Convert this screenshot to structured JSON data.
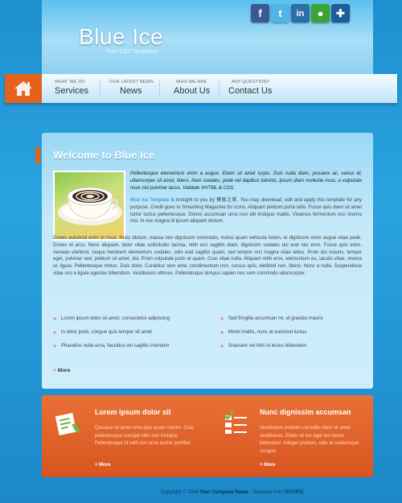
{
  "header": {
    "title": "Blue Ice",
    "tagline": "Free CSS Templates",
    "social": [
      {
        "name": "facebook-icon",
        "glyph": "f"
      },
      {
        "name": "twitter-icon",
        "glyph": "t"
      },
      {
        "name": "linkedin-icon",
        "glyph": "in"
      },
      {
        "name": "chat-icon",
        "glyph": "●"
      },
      {
        "name": "myspace-icon",
        "glyph": "✚"
      }
    ]
  },
  "nav": {
    "items": [
      {
        "small": "WHAT WE DO",
        "label": "Services"
      },
      {
        "small": "OUR LATEST NEWS",
        "label": "News"
      },
      {
        "small": "WHO WE ARE",
        "label": "About Us"
      },
      {
        "small": "ANY QUESTION?",
        "label": "Contact Us"
      }
    ]
  },
  "main": {
    "heading": "Welcome to Blue Ice",
    "intro": "Pellentesque elementum enim a augue. Etiam sit amet turpis. Duis nulla diam, posuere ac, varius id, ullamcorper sit amet, libero. Nam sodales, pede vel dapibus lobortis, ipsum diam molestie risus, a vulputate risus nisl pulvinar lacus. Validate XHTML & CSS.",
    "p2_prefix": "Blue Ice Template",
    "p2_rest": " is brought to you by 模板之家. You may download, edit and apply this template for any purpose. Credit goes to Smashing Magazine for icons. Aliquam pretium porta odio. Fusce quis diam sit amet tortor luctus pellentesque. Donec accumsan urna non elit tristique mattis. Vivamus fermentum orci viverra nisl. In nec magna id ipsum aliquam dictum.",
    "p3": "Donec euismod enim et risus. Nunc dictum, massa non dignissim commodo, metus quam vehicula lorem, et dignissim enim augue vitae pede. Donec et arcu. Nunc aliquam, dolor vitae sollicitudin lacinia, nibh orci sagittis diam, dignissim sodales dui erat nec eros. Fusce quis enim. Aenean eleifend, neque hendrerit elementum sodales, odio erat sagittis quam, sed tempor orci magna vitae tellus. Proin dui mauris, tempor eget, pulvinar sed, pretium sit amet, dui. Proin vulputate justo et quam. Cras vitae nulla. Aliquam nibh eros, elementum eu, iaculis vitae, viverra ut, ligula. Pellentesque metus. Duis dolor. Curabitur sem ante, condimentum non, cursus quis, eleifend non, libero. Nunc a nulla. Suspendisse vitae orci a ligula egestas bibendum. Vestibulum ultrices. Pellentesque tempus sapien nec sem commodo ullamcorper.",
    "list_left": [
      "Lorem ipsum dolor sit amet, consectetur adipiscing",
      "In dolor justo, congue quis tempor sit amet",
      "Phasellus nulla urna, faucibus vel sagittis interdum"
    ],
    "list_right": [
      "Sed fringilla accumsan mi, et gravida mauris",
      "Morbi mattis, nunc at euismod luctus",
      "Sraesent vel felis id lectus bibendum"
    ],
    "more": "More"
  },
  "boxes": [
    {
      "title": "Lorem ipsum dolor sit",
      "text": "Quisque sit amet urna quis quam rutrum. Cras pellentesque suscipit nibh non tristique. Pellentesque id velit non urna auctor porttitor.",
      "more": "More"
    },
    {
      "title": "Nunc dignissim accumsan",
      "text": "Vestibulum pretium convallis diam sit amet vestibulum. Etiam sit est eget leo luctus bibendum. Integer pretium, odio at scelerisque congue.",
      "more": "More"
    }
  ],
  "footer": {
    "prefix": "Copyright © 2048 ",
    "company": "Your Company Name",
    "suffix": " - Template from 网站模板"
  },
  "colors": {
    "accent": "#e4621b",
    "link": "#1b7fc6"
  }
}
